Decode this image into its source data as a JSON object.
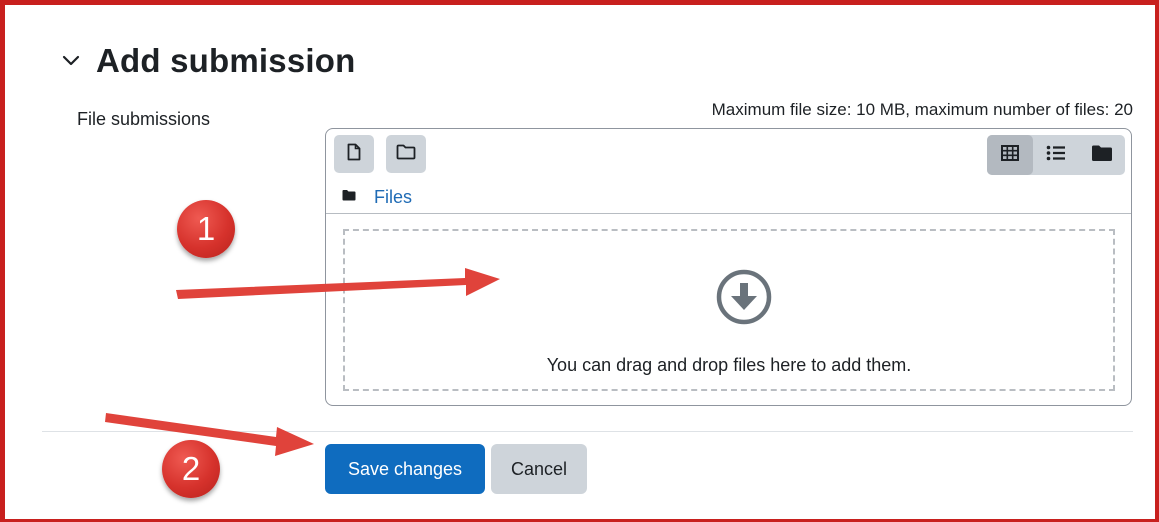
{
  "section": {
    "title": "Add submission",
    "chevron_icon": "chevron-down-icon"
  },
  "field": {
    "label": "File submissions",
    "limits": "Maximum file size: 10 MB, maximum number of files: 20"
  },
  "filemanager": {
    "toolbar": {
      "add_file_icon": "file-icon",
      "create_folder_icon": "folder-icon",
      "views": [
        {
          "name": "grid-view-icon",
          "active": true
        },
        {
          "name": "list-view-icon",
          "active": false
        },
        {
          "name": "tree-view-icon",
          "active": false
        }
      ]
    },
    "path": {
      "icon": "folder-icon",
      "label": "Files"
    },
    "dropzone": {
      "icon": "download-icon",
      "text": "You can drag and drop files here to add them."
    }
  },
  "actions": {
    "save_label": "Save changes",
    "cancel_label": "Cancel"
  },
  "annotations": {
    "marker_1": "1",
    "marker_2": "2",
    "color": "#d6322c"
  },
  "colors": {
    "primary": "#0f6cbf",
    "secondary": "#ced4da",
    "link": "#1f6bb5",
    "frame": "#c8201e"
  }
}
